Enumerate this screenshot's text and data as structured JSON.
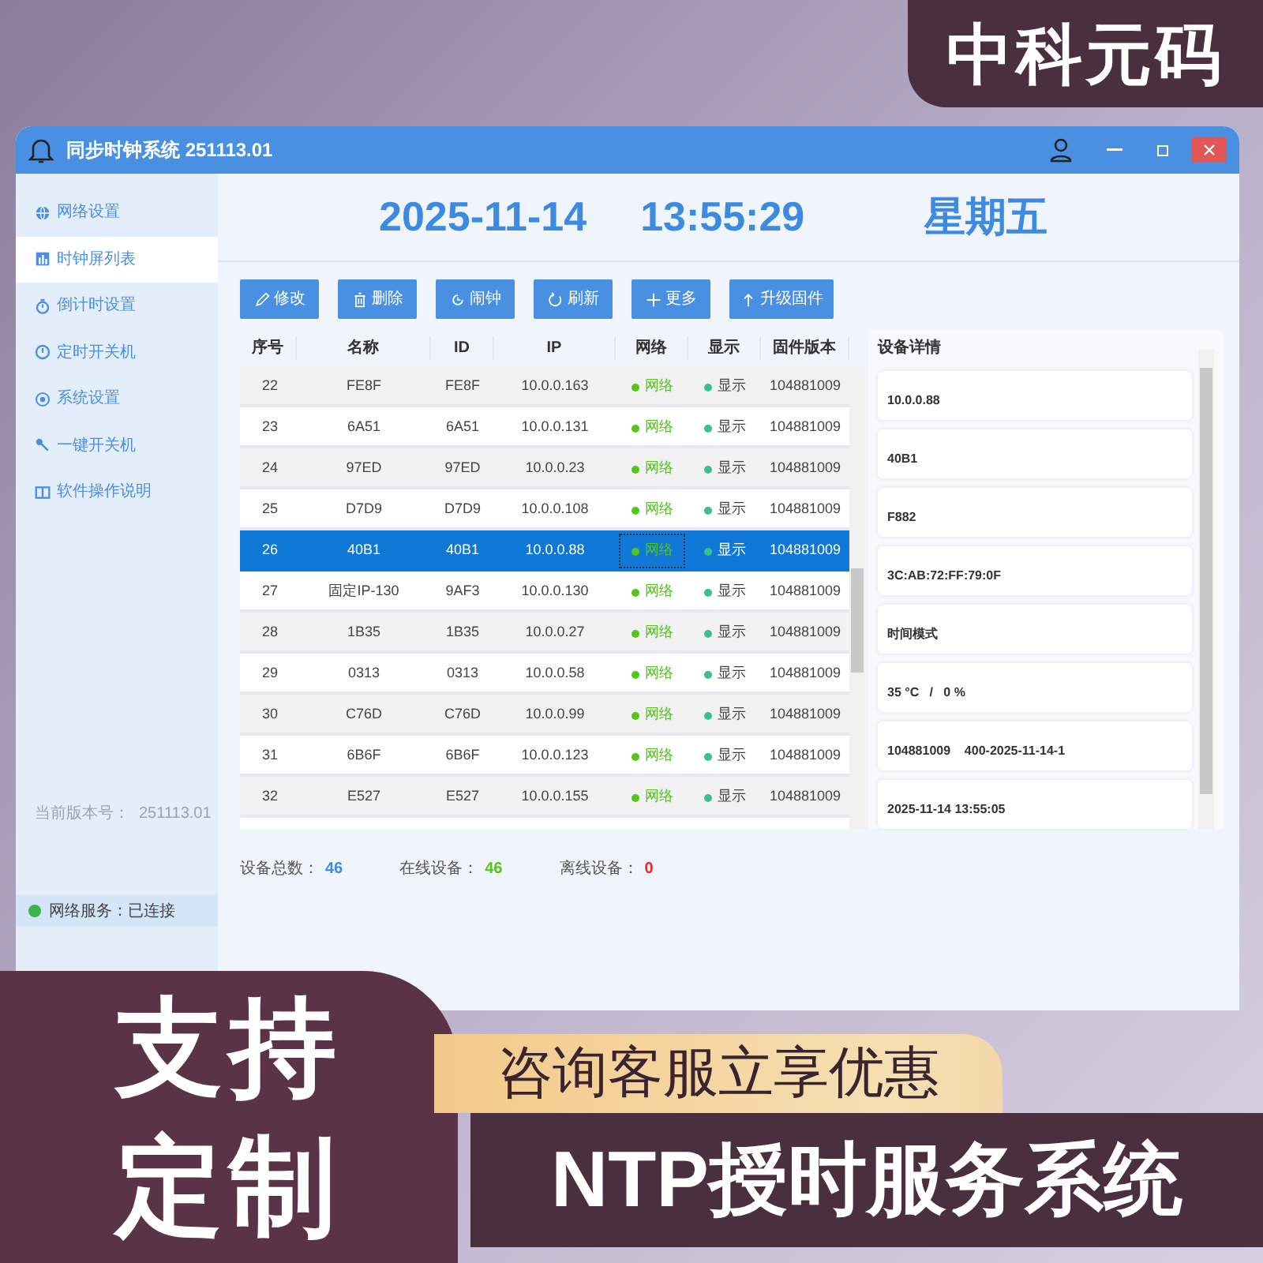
{
  "window": {
    "title": "同步时钟系统 251113.01"
  },
  "sidebar": {
    "items": [
      {
        "label": "网络设置",
        "selected": false
      },
      {
        "label": "时钟屏列表",
        "selected": true
      },
      {
        "label": "倒计时设置",
        "selected": false
      },
      {
        "label": "定时开关机",
        "selected": false
      },
      {
        "label": "系统设置",
        "selected": false
      },
      {
        "label": "一键开关机",
        "selected": false
      },
      {
        "label": "软件操作说明",
        "selected": false
      }
    ],
    "version_label": "当前版本号：",
    "version": "251113.01",
    "status": "网络服务：已连接"
  },
  "clock": {
    "date": "2025-11-14",
    "time": "13:55:29",
    "weekday": "星期五"
  },
  "toolbar": [
    {
      "label": "修改"
    },
    {
      "label": "删除"
    },
    {
      "label": "闹钟"
    },
    {
      "label": "刷新"
    },
    {
      "label": "更多"
    },
    {
      "label": "升级固件"
    }
  ],
  "table": {
    "columns": [
      "序号",
      "名称",
      "ID",
      "IP",
      "网络",
      "显示",
      "固件版本"
    ],
    "rows": [
      {
        "cells": [
          "22",
          "FE8F",
          "FE8F",
          "10.0.0.163",
          "网络",
          "显示",
          "104881009"
        ],
        "selected": false
      },
      {
        "cells": [
          "23",
          "6A51",
          "6A51",
          "10.0.0.131",
          "网络",
          "显示",
          "104881009"
        ],
        "selected": false
      },
      {
        "cells": [
          "24",
          "97ED",
          "97ED",
          "10.0.0.23",
          "网络",
          "显示",
          "104881009"
        ],
        "selected": false
      },
      {
        "cells": [
          "25",
          "D7D9",
          "D7D9",
          "10.0.0.108",
          "网络",
          "显示",
          "104881009"
        ],
        "selected": false
      },
      {
        "cells": [
          "26",
          "40B1",
          "40B1",
          "10.0.0.88",
          "网络",
          "显示",
          "104881009"
        ],
        "selected": true
      },
      {
        "cells": [
          "27",
          "固定IP-130",
          "9AF3",
          "10.0.0.130",
          "网络",
          "显示",
          "104881009"
        ],
        "selected": false
      },
      {
        "cells": [
          "28",
          "1B35",
          "1B35",
          "10.0.0.27",
          "网络",
          "显示",
          "104881009"
        ],
        "selected": false
      },
      {
        "cells": [
          "29",
          "0313",
          "0313",
          "10.0.0.58",
          "网络",
          "显示",
          "104881009"
        ],
        "selected": false
      },
      {
        "cells": [
          "30",
          "C76D",
          "C76D",
          "10.0.0.99",
          "网络",
          "显示",
          "104881009"
        ],
        "selected": false
      },
      {
        "cells": [
          "31",
          "6B6F",
          "6B6F",
          "10.0.0.123",
          "网络",
          "显示",
          "104881009"
        ],
        "selected": false
      },
      {
        "cells": [
          "32",
          "E527",
          "E527",
          "10.0.0.155",
          "网络",
          "显示",
          "104881009"
        ],
        "selected": false
      }
    ]
  },
  "details": {
    "title": "设备详情",
    "fields": [
      "10.0.0.88",
      "40B1",
      "F882",
      "3C:AB:72:FF:79:0F",
      "时间模式",
      "35 °C   /   0 %",
      "104881009    400-2025-11-14-1",
      "2025-11-14 13:55:05"
    ]
  },
  "stats": [
    {
      "label": "设备总数：",
      "value": "46",
      "color": "#3d8be0"
    },
    {
      "label": "在线设备：",
      "value": "46",
      "color": "#52c41a"
    },
    {
      "label": "离线设备：",
      "value": "0",
      "color": "#f5222d"
    }
  ],
  "promo": {
    "brand": "中科元码",
    "badge_lines": [
      "支持",
      "定制"
    ],
    "offer": "咨询客服立享优惠",
    "product": "NTP授时服务系统"
  }
}
